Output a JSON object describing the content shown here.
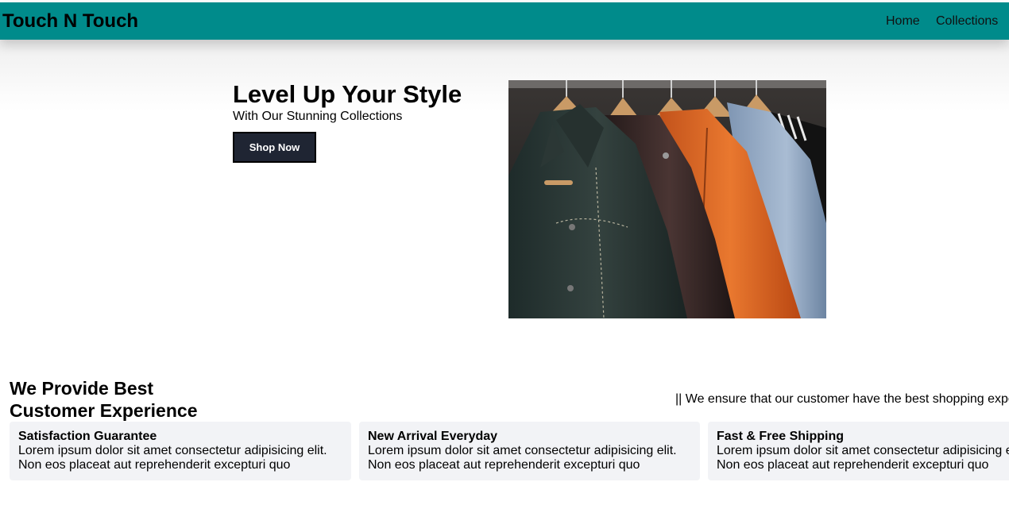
{
  "nav": {
    "brand": "Touch N Touch",
    "links": [
      {
        "label": "Home"
      },
      {
        "label": "Collections"
      }
    ],
    "bg_color": "#008b8b"
  },
  "hero": {
    "title": "Level Up Your Style",
    "subtitle": "With Our Stunning Collections",
    "cta_label": "Shop Now",
    "image_subject": "leather-jackets-on-hangers"
  },
  "features": {
    "title_line1": "We Provide Best",
    "title_line2": "Customer Experience",
    "marquee": "|| We ensure that our customer have the best shopping expe",
    "cards": [
      {
        "title": "Satisfaction Guarantee",
        "line1": "Lorem ipsum dolor sit amet consectetur adipisicing elit.",
        "line2": "Non eos placeat aut reprehenderit excepturi quo"
      },
      {
        "title": "New Arrival Everyday",
        "line1": "Lorem ipsum dolor sit amet consectetur adipisicing elit.",
        "line2": "Non eos placeat aut reprehenderit excepturi quo"
      },
      {
        "title": "Fast & Free Shipping",
        "line1": "Lorem ipsum dolor sit amet consectetur adipisicing elit.",
        "line2": "Non eos placeat aut reprehenderit excepturi quo"
      }
    ]
  }
}
